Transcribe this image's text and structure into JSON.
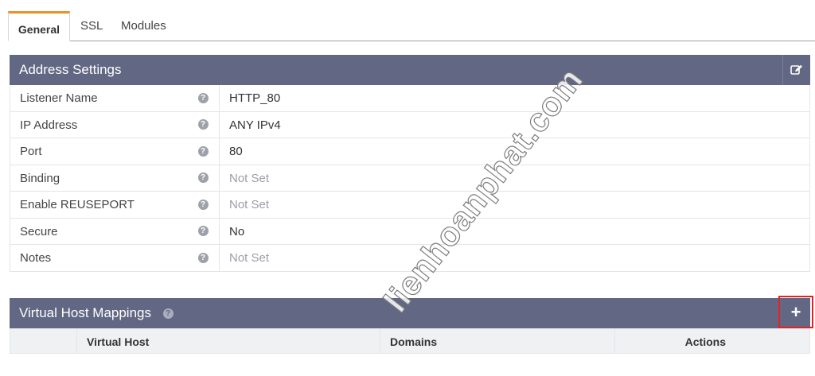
{
  "tabs": [
    {
      "label": "General",
      "active": true
    },
    {
      "label": "SSL",
      "active": false
    },
    {
      "label": "Modules",
      "active": false
    }
  ],
  "address_settings": {
    "title": "Address Settings",
    "rows": [
      {
        "label": "Listener Name",
        "value": "HTTP_80",
        "set": true
      },
      {
        "label": "IP Address",
        "value": "ANY IPv4",
        "set": true
      },
      {
        "label": "Port",
        "value": "80",
        "set": true
      },
      {
        "label": "Binding",
        "value": "Not Set",
        "set": false
      },
      {
        "label": "Enable REUSEPORT",
        "value": "Not Set",
        "set": false
      },
      {
        "label": "Secure",
        "value": "No",
        "set": true
      },
      {
        "label": "Notes",
        "value": "Not Set",
        "set": false
      }
    ]
  },
  "virtual_host_mappings": {
    "title": "Virtual Host Mappings",
    "columns": [
      "Virtual Host",
      "Domains",
      "Actions"
    ],
    "add_label": "+"
  },
  "watermark": "lienhoanphat.com",
  "icons": {
    "edit": "edit-icon",
    "help": "help-icon",
    "add": "plus-icon"
  },
  "colors": {
    "header": "#626883",
    "active_tab": "#e8912a",
    "highlight": "#e02424"
  }
}
